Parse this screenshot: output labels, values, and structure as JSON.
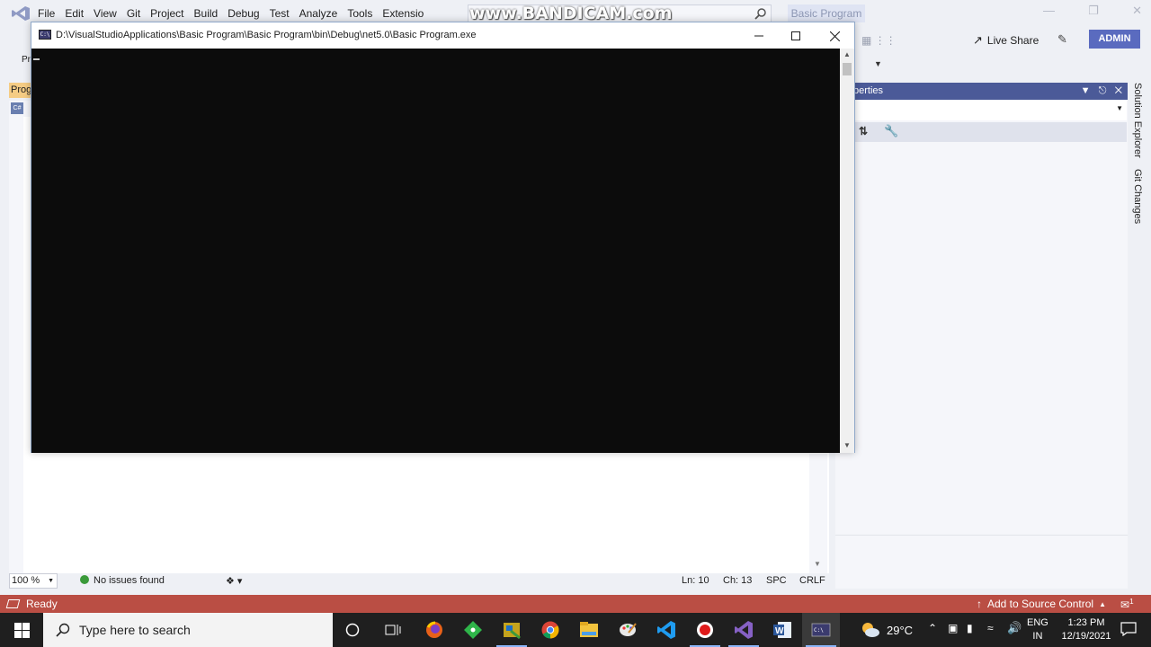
{
  "vs": {
    "menu": [
      "File",
      "Edit",
      "View",
      "Git",
      "Project",
      "Build",
      "Debug",
      "Test",
      "Analyze",
      "Tools",
      "Extensio"
    ],
    "solution_name": "Basic Program",
    "watermark": "www.BANDICAM.com",
    "live_share": "Live Share",
    "account": "ADMIN",
    "doc_tab": "Prog",
    "toolbar_fragment": "Pr",
    "editor_status": {
      "zoom": "100 %",
      "issues": "No issues found",
      "line": "Ln: 10",
      "col": "Ch: 13",
      "spaces": "SPC",
      "line_ending": "CRLF"
    },
    "properties_title": "perties",
    "side_tabs": [
      "Solution Explorer",
      "Git Changes"
    ],
    "status": {
      "ready": "Ready",
      "source_control": "Add to Source Control",
      "notification_count": "1"
    },
    "colors": {
      "accent": "#5a6bbf",
      "statusbar": "#ba4e44",
      "panel_header": "#4b5a98"
    }
  },
  "console": {
    "title": "D:\\VisualStudioApplications\\Basic Program\\Basic Program\\bin\\Debug\\net5.0\\Basic Program.exe",
    "controls": [
      "minimize",
      "maximize",
      "close"
    ]
  },
  "taskbar": {
    "search_placeholder": "Type here to search",
    "apps": [
      "cortana-icon",
      "task-view-icon",
      "firefox-icon",
      "git-icon",
      "filezilla-icon",
      "chrome-icon",
      "file-explorer-icon",
      "paint-icon",
      "vscode-icon",
      "record-icon",
      "visual-studio-icon",
      "word-icon",
      "console-icon"
    ],
    "weather": "29°C",
    "lang": "ENG",
    "region": "IN",
    "time": "1:23 PM",
    "date": "12/19/2021"
  }
}
